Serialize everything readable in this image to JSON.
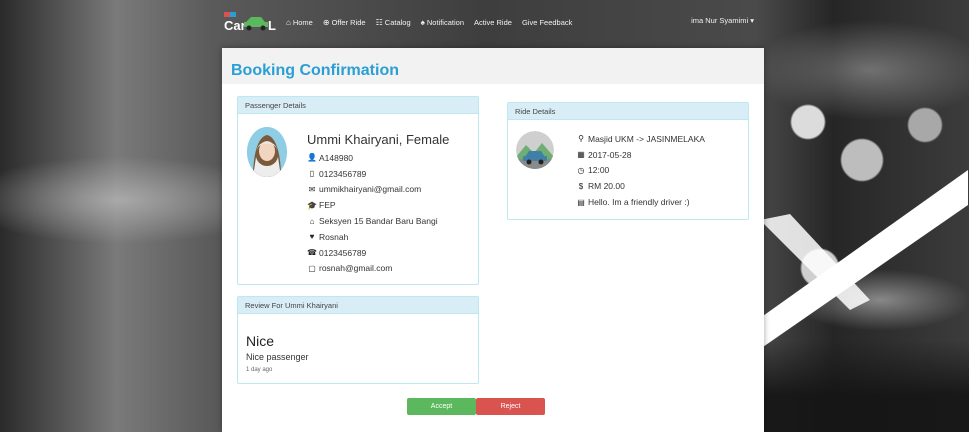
{
  "nav": {
    "logo_text": "CarPooL",
    "items": [
      {
        "icon": "home-icon",
        "glyph": "⌂",
        "label": "Home"
      },
      {
        "icon": "plus-icon",
        "glyph": "⊕",
        "label": "Offer Ride"
      },
      {
        "icon": "list-icon",
        "glyph": "☷",
        "label": "Catalog"
      },
      {
        "icon": "bell-icon",
        "glyph": "♠",
        "label": "Notification"
      },
      {
        "icon": "",
        "glyph": "",
        "label": "Active Ride"
      },
      {
        "icon": "",
        "glyph": "",
        "label": "Give Feedback"
      }
    ],
    "user_label": "ima Nur Syamimi ▾"
  },
  "page": {
    "title": "Booking Confirmation"
  },
  "passenger": {
    "heading": "Passenger Details",
    "name_line": "Ummi Khairyani, Female",
    "fields": [
      {
        "icon": "user-icon",
        "glyph": "👤",
        "value": "A148980"
      },
      {
        "icon": "mobile-phone-icon",
        "glyph": "▯",
        "value": "0123456789"
      },
      {
        "icon": "envelope-icon",
        "glyph": "✉",
        "value": "ummikhairyani@gmail.com"
      },
      {
        "icon": "graduation-cap-icon",
        "glyph": "🎓",
        "value": "FEP"
      },
      {
        "icon": "home-icon",
        "glyph": "⌂",
        "value": "Seksyen 15 Bandar Baru Bangi"
      },
      {
        "icon": "heart-icon",
        "glyph": "♥",
        "value": "Rosnah"
      },
      {
        "icon": "phone-icon",
        "glyph": "☎",
        "value": "0123456789"
      },
      {
        "icon": "envelope-outline-icon",
        "glyph": "▢",
        "value": "rosnah@gmail.com"
      }
    ]
  },
  "ride": {
    "heading": "Ride Details",
    "fields": [
      {
        "icon": "map-marker-icon",
        "glyph": "⚲",
        "value": "Masjid UKM -> JASINMELAKA"
      },
      {
        "icon": "calendar-icon",
        "glyph": "▦",
        "value": "2017-05-28"
      },
      {
        "icon": "clock-icon",
        "glyph": "◷",
        "value": "12:00"
      },
      {
        "icon": "dollar-icon",
        "glyph": "$",
        "value": "RM 20.00"
      },
      {
        "icon": "note-icon",
        "glyph": "▤",
        "value": "Hello. Im a friendly driver :)"
      }
    ]
  },
  "review": {
    "heading": "Review For Ummi Khairyani",
    "title": "Nice",
    "text": "Nice passenger",
    "time": "1 day ago"
  },
  "actions": {
    "accept_label": "Accept",
    "reject_label": "Reject",
    "accept_color": "#5cb85c",
    "reject_color": "#d9534f"
  },
  "colors": {
    "title": "#2a9fd6",
    "panel_heading_bg": "#d9edf7",
    "panel_border": "#bce8f1"
  }
}
